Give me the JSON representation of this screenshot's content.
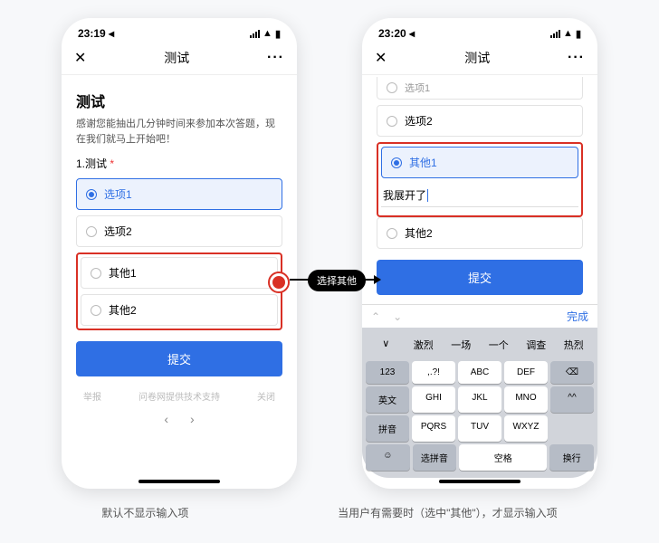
{
  "left": {
    "time": "23:19 ◂",
    "nav_title": "测试",
    "page_title": "测试",
    "intro": "感谢您能抽出几分钟时间来参加本次答题，现在我们就马上开始吧！",
    "q1_label": "1.测试",
    "opts": {
      "o1": "选项1",
      "o2": "选项2",
      "o3": "其他1",
      "o4": "其他2"
    },
    "submit": "提交",
    "footer": {
      "l": "举报",
      "c": "问卷网提供技术支持",
      "r": "关闭"
    }
  },
  "right": {
    "time": "23:20 ◂",
    "nav_title": "测试",
    "cut": "选项1",
    "o2": "选项2",
    "o3": "其他1",
    "input_val": "我展开了",
    "o4": "其他2",
    "submit": "提交",
    "done": "完成",
    "sug": [
      "∨",
      "激烈",
      "一场",
      "一个",
      "调查",
      "热烈"
    ],
    "rows": [
      [
        "123",
        ",.?!",
        "ABC",
        "DEF",
        "⌫"
      ],
      [
        "英文",
        "GHI",
        "JKL",
        "MNO",
        "^^"
      ],
      [
        "拼音",
        "PQRS",
        "TUV",
        "WXYZ",
        ""
      ],
      [
        "☺",
        "选拼音",
        "空格",
        "",
        "换行"
      ]
    ]
  },
  "annot": {
    "pill": "选择其他"
  },
  "captions": {
    "l": "默认不显示输入项",
    "r": "当用户有需要时（选中\"其他\"），才显示输入项"
  }
}
